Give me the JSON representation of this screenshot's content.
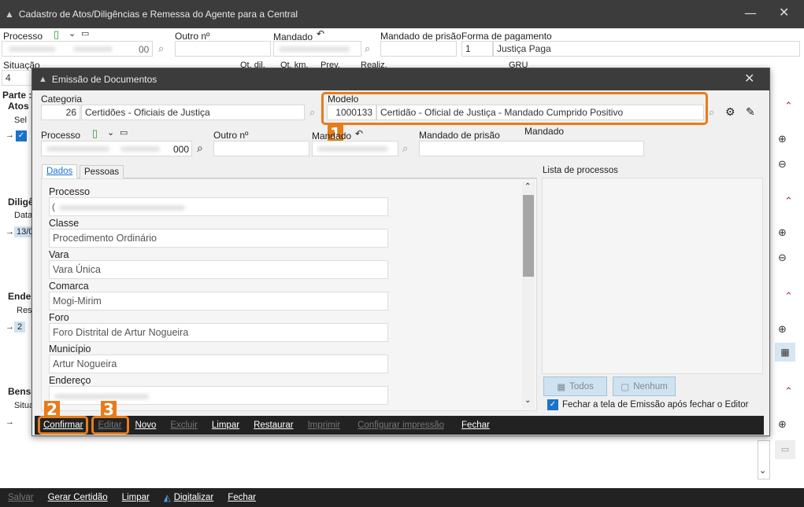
{
  "main_window": {
    "title": "Cadastro de Atos/Diligências e Remessa do Agente para a Central",
    "labels": {
      "processo": "Processo",
      "outro_numero": "Outro nº",
      "mandado": "Mandado",
      "mandado_prisao": "Mandado de prisão",
      "forma_pagamento": "Forma de pagamento",
      "situacao": "Situação",
      "ot_dil": "Ot. dil.",
      "ot_km": "Ot. km.",
      "prev": "Prev.",
      "realiz": "Realiz.",
      "gru": "GRU",
      "parte": "Parte : .",
      "atos": "Atos",
      "sel": "Sel",
      "diligencias": "Diligê",
      "data": "Data",
      "data_value": "13/0",
      "enderecos": "Ender",
      "res": "Res",
      "res_value": "2",
      "bens": "Bens",
      "situ": "Situa"
    },
    "processo_suffix": "00",
    "forma_pagamento_code": "1",
    "forma_pagamento_value": "Justiça Paga",
    "situacao_value": "4",
    "bottom_toolbar": [
      "Salvar",
      "Gerar Certidão",
      "Limpar",
      "Digitalizar",
      "Fechar"
    ]
  },
  "dialog": {
    "title": "Emissão de Documentos",
    "categoria_label": "Categoria",
    "categoria_code": "26",
    "categoria_value": "Certidões - Oficiais de Justiça",
    "modelo_label": "Modelo",
    "modelo_code": "1000133",
    "modelo_value": "Certidão - Oficial de Justiça - Mandado Cumprido Positivo",
    "processo_label": "Processo",
    "processo_suffix": "000",
    "outro_numero_label": "Outro nº",
    "mandado_label": "Mandado",
    "mandado_prisao_label": "Mandado de prisão",
    "mandado_label_right": "Mandado",
    "tabs": [
      "Dados",
      "Pessoas"
    ],
    "fields": [
      {
        "label": "Processo",
        "value": "("
      },
      {
        "label": "Classe",
        "value": "Procedimento Ordinário"
      },
      {
        "label": "Vara",
        "value": "Vara Única"
      },
      {
        "label": "Comarca",
        "value": "Mogi-Mirim"
      },
      {
        "label": "Foro",
        "value": "Foro Distrital de Artur Nogueira"
      },
      {
        "label": "Município",
        "value": "Artur Nogueira"
      },
      {
        "label": "Endereço",
        "value": ""
      }
    ],
    "lista_processos_label": "Lista de processos",
    "todos_label": "Todos",
    "nenhum_label": "Nenhum",
    "fechar_checkbox_label": "Fechar a tela de Emissão após fechar o Editor",
    "toolbar": [
      "Confirmar",
      "Editar",
      "Novo",
      "Excluir",
      "Limpar",
      "Restaurar",
      "Imprimir",
      "Configurar impressão",
      "Fechar"
    ]
  },
  "callouts": [
    "1",
    "2",
    "3"
  ],
  "colors": {
    "accent": "#e77c1b",
    "titlebar": "#3c3c3c",
    "toolbar": "#222222",
    "link_blue": "#1a73c8"
  }
}
